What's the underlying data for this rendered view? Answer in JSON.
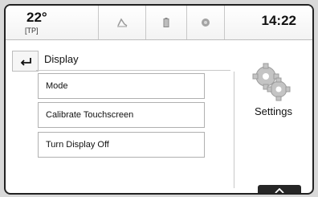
{
  "status_bar": {
    "temperature": "22°",
    "temperature_sub": "[TP]",
    "time": "14:22",
    "icons": [
      "phone-icon",
      "battery-icon",
      "media-icon"
    ]
  },
  "header": {
    "back_icon": "back-arrow-icon",
    "title": "Display"
  },
  "menu": {
    "items": [
      {
        "label": "Mode"
      },
      {
        "label": "Calibrate Touchscreen"
      },
      {
        "label": "Turn Display Off"
      }
    ]
  },
  "settings_panel": {
    "icon": "gears-icon",
    "label": "Settings"
  },
  "footer": {
    "up_icon": "chevron-up-icon"
  }
}
